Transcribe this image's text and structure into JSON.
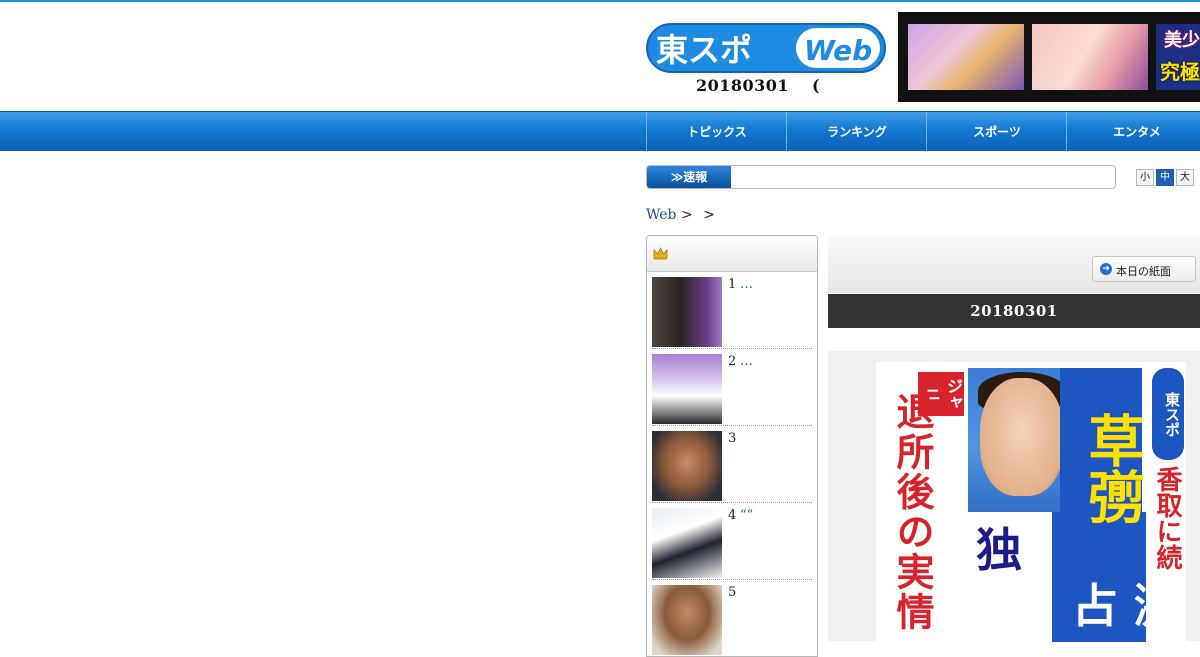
{
  "header": {
    "logo_text": "東スポWeb",
    "issue_date": "20180301",
    "issue_paren": "(",
    "banner": {
      "line1": "美少",
      "line2": "究極"
    }
  },
  "nav": {
    "items": [
      {
        "label": "トピックス"
      },
      {
        "label": "ランキング"
      },
      {
        "label": "スポーツ"
      },
      {
        "label": "エンタメ"
      }
    ]
  },
  "sokuho": {
    "label": "≫速報"
  },
  "font_size": {
    "small": "小",
    "medium": "中",
    "large": "大"
  },
  "breadcrumb": {
    "home": "Web",
    "sep1": ">",
    "sep2": ">"
  },
  "ranking": {
    "items": [
      {
        "rank": "1",
        "title": "…"
      },
      {
        "rank": "2",
        "title": "…"
      },
      {
        "rank": "3",
        "title": ""
      },
      {
        "rank": "4",
        "title": "“”"
      },
      {
        "rank": "5",
        "title": ""
      }
    ]
  },
  "paper": {
    "today_button": "本日の紙面",
    "date": "20180301",
    "front_page": {
      "jani": "ジャニ",
      "headline_red": "退所後の実情",
      "headline_big": "草彅",
      "tospo": "東スポ",
      "katori": "香取に続",
      "doku": "独",
      "big2": "占 激"
    }
  },
  "colors": {
    "nav_blue": "#1479d2",
    "accent_blue": "#1d8fdc",
    "date_bar": "#333333",
    "paper_red": "#d8232a"
  }
}
